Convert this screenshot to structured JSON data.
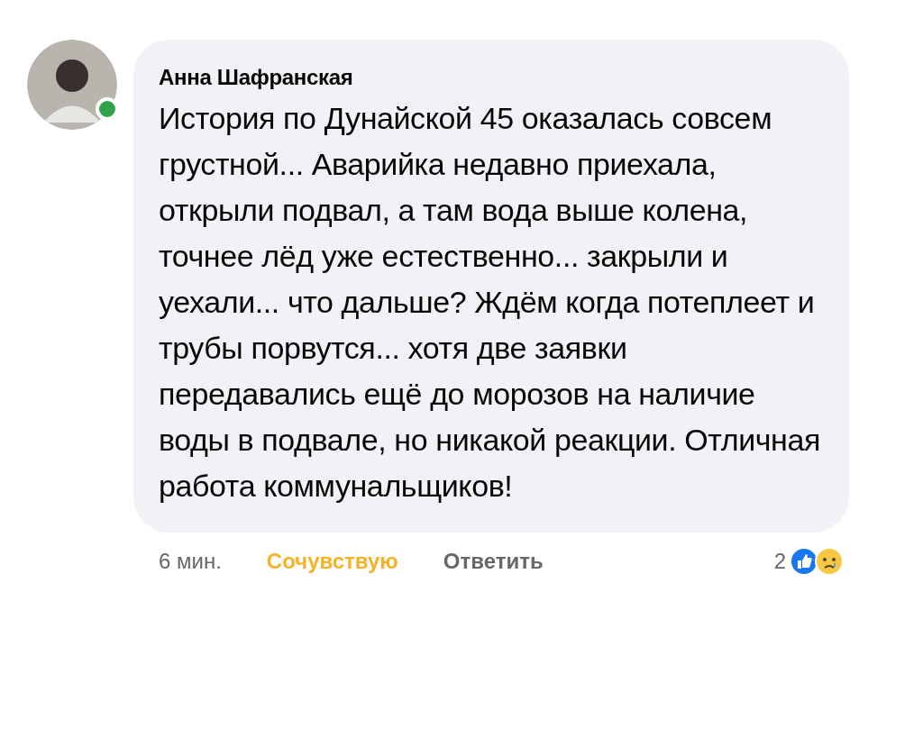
{
  "comment": {
    "author": "Анна Шафранская",
    "online": true,
    "text": "История по Дунайской 45 оказалась совсем грустной... Аварийка недавно приехала, открыли подвал, а там вода выше колена, точнее лёд уже естественно... закрыли и уехали... что дальше? Ждём когда потеплеет и трубы порвутся... хотя две заявки передавались ещё до морозов на наличие воды в подвале, но никакой реакции. Отличная работа коммунальщиков!",
    "time": "6 мин.",
    "reaction_button": {
      "label": "Сочувствую",
      "selected": true
    },
    "reply_button": "Ответить",
    "reaction_count": "2"
  }
}
